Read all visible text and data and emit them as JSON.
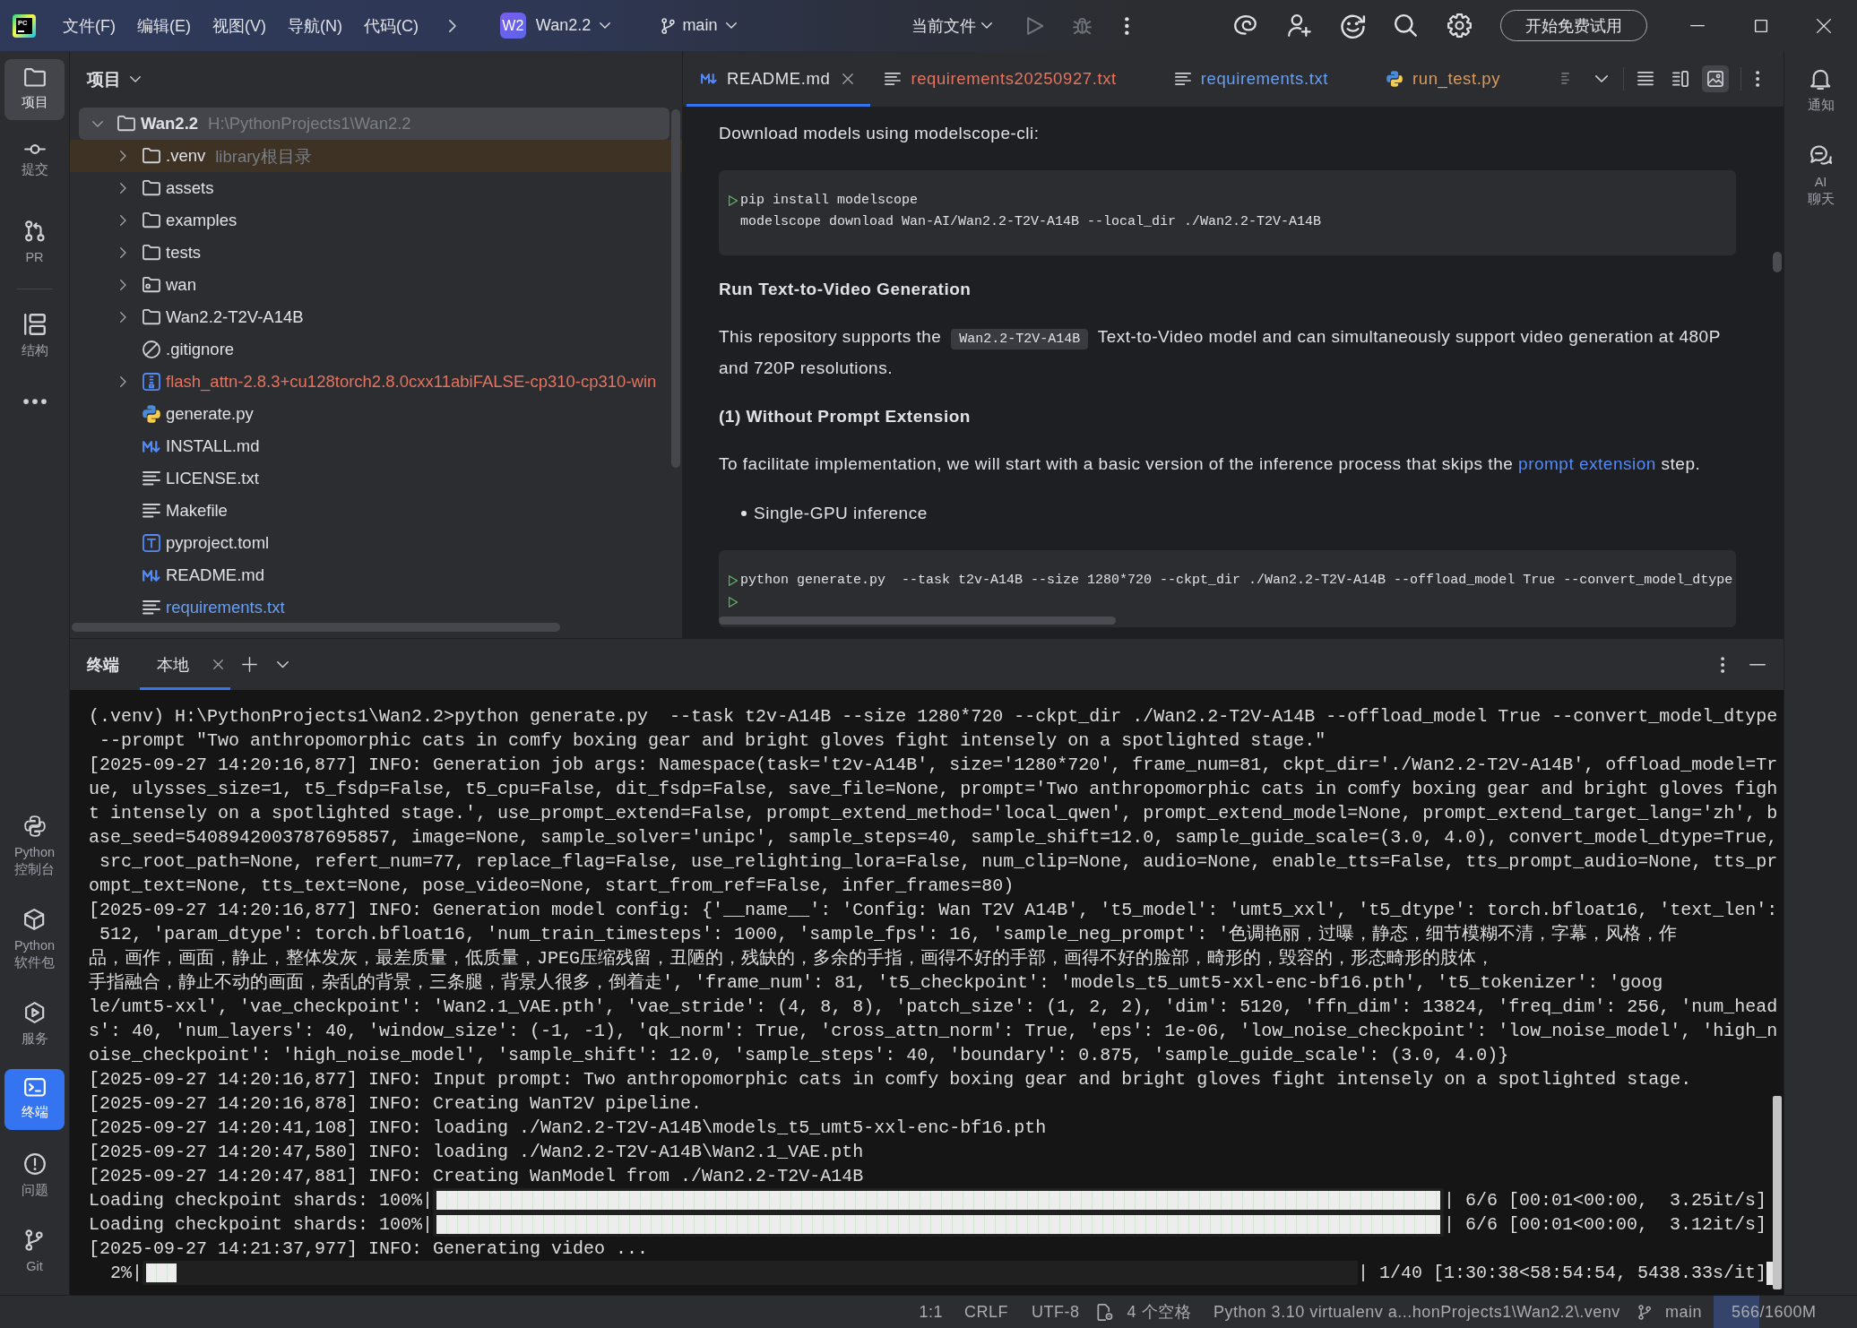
{
  "title_bar": {
    "logo": "PC",
    "menus": [
      "文件(F)",
      "编辑(E)",
      "视图(V)",
      "导航(N)",
      "代码(C)"
    ],
    "project": {
      "badge": "W2",
      "name": "Wan2.2"
    },
    "branch": "main",
    "run_config": "当前文件",
    "run_controls": [
      {
        "kind": "run",
        "disabled": true
      },
      {
        "kind": "debug",
        "disabled": true
      }
    ],
    "trial_button": "开始免费试用"
  },
  "left_toolbar": {
    "top_groups": [
      [
        {
          "kind": "folder",
          "label": "项目",
          "selected": true,
          "focused": false
        },
        {
          "kind": "commit",
          "label": "提交",
          "selected": false,
          "focused": false
        },
        {
          "kind": "pull-request",
          "label": "PR",
          "selected": false,
          "focused": false
        }
      ],
      [
        {
          "kind": "structure",
          "label": "结构",
          "selected": false,
          "focused": false
        }
      ]
    ],
    "bottom": [
      {
        "kind": "python-console",
        "label": "Python 控制台",
        "selected": false,
        "focused": false
      },
      {
        "kind": "python-packages",
        "label": "Python 软件包",
        "selected": false,
        "focused": false
      },
      {
        "kind": "services",
        "label": "服务",
        "selected": false,
        "focused": false
      },
      {
        "kind": "terminal",
        "label": "终端",
        "selected": true,
        "focused": true
      },
      {
        "kind": "problems",
        "label": "问题",
        "selected": false,
        "focused": false
      },
      {
        "kind": "git",
        "label": "Git",
        "selected": false,
        "focused": false
      }
    ]
  },
  "right_toolbar": {
    "items": [
      {
        "kind": "bell",
        "label": "通知"
      },
      {
        "kind": "ai-chat",
        "label": "AI 聊天"
      }
    ]
  },
  "project_panel": {
    "title": "项目",
    "tree": [
      {
        "name": "Wan2.2",
        "note": "H:\\PythonProjects1\\Wan2.2",
        "kind": "folder",
        "expanded": true,
        "selected": true,
        "highlighted": false,
        "color": "#dfe1e5",
        "children": [
          {
            "name": ".venv",
            "note": "library根目录",
            "kind": "folder",
            "expanded": false,
            "selected": false,
            "highlighted": true,
            "color": "#dfe1e5"
          },
          {
            "name": "assets",
            "kind": "folder",
            "expanded": false,
            "selected": false,
            "highlighted": false,
            "color": "#dfe1e5"
          },
          {
            "name": "examples",
            "kind": "folder",
            "expanded": false,
            "selected": false,
            "highlighted": false,
            "color": "#dfe1e5"
          },
          {
            "name": "tests",
            "kind": "folder",
            "expanded": false,
            "selected": false,
            "highlighted": false,
            "color": "#dfe1e5"
          },
          {
            "name": "wan",
            "kind": "package-folder",
            "expanded": false,
            "selected": false,
            "highlighted": false,
            "color": "#dfe1e5"
          },
          {
            "name": "Wan2.2-T2V-A14B",
            "kind": "folder",
            "expanded": false,
            "selected": false,
            "highlighted": false,
            "color": "#dfe1e5"
          },
          {
            "name": ".gitignore",
            "kind": "ignore",
            "selected": false,
            "highlighted": false,
            "color": "#dfe1e5"
          },
          {
            "name": "flash_attn-2.8.3+cu128torch2.8.0cxx11abiFALSE-cp310-cp310-win",
            "kind": "archive",
            "expanded": false,
            "selected": false,
            "highlighted": false,
            "color": "#e5735f"
          },
          {
            "name": "generate.py",
            "kind": "python",
            "selected": false,
            "highlighted": false,
            "color": "#dfe1e5"
          },
          {
            "name": "INSTALL.md",
            "kind": "markdown",
            "selected": false,
            "highlighted": false,
            "color": "#dfe1e5"
          },
          {
            "name": "LICENSE.txt",
            "kind": "text",
            "selected": false,
            "highlighted": false,
            "color": "#dfe1e5"
          },
          {
            "name": "Makefile",
            "kind": "text",
            "selected": false,
            "highlighted": false,
            "color": "#dfe1e5"
          },
          {
            "name": "pyproject.toml",
            "kind": "toml",
            "selected": false,
            "highlighted": false,
            "color": "#dfe1e5"
          },
          {
            "name": "README.md",
            "kind": "markdown",
            "selected": false,
            "highlighted": false,
            "color": "#dfe1e5"
          },
          {
            "name": "requirements.txt",
            "kind": "text",
            "selected": false,
            "highlighted": false,
            "color": "#6a9ff0"
          }
        ]
      }
    ]
  },
  "editor": {
    "tabs": [
      {
        "label": "README.md",
        "kind": "markdown",
        "selected": true,
        "color": "#dfe1e5"
      },
      {
        "label": "requirements20250927.txt",
        "kind": "text",
        "selected": false,
        "color": "#e5735f"
      },
      {
        "label": "requirements.txt",
        "kind": "text",
        "selected": false,
        "color": "#6a9ff0"
      },
      {
        "label": "run_test.py",
        "kind": "python",
        "selected": false,
        "color": "#d99a5e"
      }
    ],
    "view_modes": [
      {
        "kind": "editor",
        "selected": false
      },
      {
        "kind": "split",
        "selected": false
      },
      {
        "kind": "preview",
        "selected": true
      }
    ],
    "blocks": [
      {
        "kind": "paragraph",
        "parts": [
          {
            "kind": "text",
            "text": "Download models using modelscope-cli:"
          }
        ]
      },
      {
        "kind": "code",
        "scrollable": false,
        "lines": [
          {
            "text": "pip install modelscope",
            "run": true
          },
          {
            "text": "modelscope download Wan-AI/Wan2.2-T2V-A14B --local_dir ./Wan2.2-T2V-A14B",
            "run": false
          }
        ]
      },
      {
        "kind": "heading",
        "text": "Run Text-to-Video Generation"
      },
      {
        "kind": "paragraph",
        "parts": [
          {
            "kind": "text",
            "text": "This repository supports the "
          },
          {
            "kind": "code",
            "text": "Wan2.2-T2V-A14B"
          },
          {
            "kind": "text",
            "text": " Text-to-Video model and can simultaneously support video generation at 480P and 720P resolutions."
          }
        ]
      },
      {
        "kind": "heading",
        "text": "(1) Without Prompt Extension"
      },
      {
        "kind": "paragraph",
        "parts": [
          {
            "kind": "text",
            "text": "To facilitate implementation, we will start with a basic version of the inference process that skips the "
          },
          {
            "kind": "link",
            "text": "prompt extension"
          },
          {
            "kind": "text",
            "text": " step."
          }
        ]
      },
      {
        "kind": "bullets",
        "items": [
          "Single-GPU inference"
        ]
      },
      {
        "kind": "code",
        "scrollable": true,
        "lines": [
          {
            "text": "python generate.py  --task t2v-A14B --size 1280*720 --ckpt_dir ./Wan2.2-T2V-A14B --offload_model True --convert_model_dtype",
            "run": true
          },
          {
            "run": true
          }
        ]
      }
    ]
  },
  "terminal": {
    "title": "终端",
    "tabs": [
      {
        "label": "本地",
        "selected": true
      }
    ],
    "lines": [
      {
        "kind": "text",
        "text": "(.venv) H:\\PythonProjects1\\Wan2.2>python generate.py  --task t2v-A14B --size 1280*720 --ckpt_dir ./Wan2.2-T2V-A14B --offload_model True --convert_model_dtype"
      },
      {
        "kind": "text",
        "text": " --prompt \"Two anthropomorphic cats in comfy boxing gear and bright gloves fight intensely on a spotlighted stage.\""
      },
      {
        "kind": "text",
        "text": "[2025-09-27 14:20:16,877] INFO: Generation job args: Namespace(task='t2v-A14B', size='1280*720', frame_num=81, ckpt_dir='./Wan2.2-T2V-A14B', offload_model=Tr"
      },
      {
        "kind": "text",
        "text": "ue, ulysses_size=1, t5_fsdp=False, t5_cpu=False, dit_fsdp=False, save_file=None, prompt='Two anthropomorphic cats in comfy boxing gear and bright gloves figh"
      },
      {
        "kind": "text",
        "text": "t intensely on a spotlighted stage.', use_prompt_extend=False, prompt_extend_method='local_qwen', prompt_extend_model=None, prompt_extend_target_lang='zh', b"
      },
      {
        "kind": "text",
        "text": "ase_seed=5408942003787695857, image=None, sample_solver='unipc', sample_steps=40, sample_shift=12.0, sample_guide_scale=(3.0, 4.0), convert_model_dtype=True,"
      },
      {
        "kind": "text",
        "text": " src_root_path=None, refert_num=77, replace_flag=False, use_relighting_lora=False, num_clip=None, audio=None, enable_tts=False, tts_prompt_audio=None, tts_pr"
      },
      {
        "kind": "text",
        "text": "ompt_text=None, tts_text=None, pose_video=None, start_from_ref=False, infer_frames=80)"
      },
      {
        "kind": "text",
        "text": "[2025-09-27 14:20:16,877] INFO: Generation model config: {'__name__': 'Config: Wan T2V A14B', 't5_model': 'umt5_xxl', 't5_dtype': torch.bfloat16, 'text_len':"
      },
      {
        "kind": "text",
        "text": " 512, 'param_dtype': torch.bfloat16, 'num_train_timesteps': 1000, 'sample_fps': 16, 'sample_neg_prompt': '色调艳丽，过曝，静态，细节模糊不清，字幕，风格，作"
      },
      {
        "kind": "text",
        "text": "品，画作，画面，静止，整体发灰，最差质量，低质量，JPEG压缩残留，丑陋的，残缺的，多余的手指，画得不好的手部，画得不好的脸部，畸形的，毁容的，形态畸形的肢体，"
      },
      {
        "kind": "text",
        "text": "手指融合，静止不动的画面，杂乱的背景，三条腿，背景人很多，倒着走', 'frame_num': 81, 't5_checkpoint': 'models_t5_umt5-xxl-enc-bf16.pth', 't5_tokenizer': 'goog"
      },
      {
        "kind": "text",
        "text": "le/umt5-xxl', 'vae_checkpoint': 'Wan2.1_VAE.pth', 'vae_stride': (4, 8, 8), 'patch_size': (1, 2, 2), 'dim': 5120, 'ffn_dim': 13824, 'freq_dim': 256, 'num_head"
      },
      {
        "kind": "text",
        "text": "s': 40, 'num_layers': 40, 'window_size': (-1, -1), 'qk_norm': True, 'cross_attn_norm': True, 'eps': 1e-06, 'low_noise_checkpoint': 'low_noise_model', 'high_n"
      },
      {
        "kind": "text",
        "text": "oise_checkpoint': 'high_noise_model', 'sample_shift': 12.0, 'sample_steps': 40, 'boundary': 0.875, 'sample_guide_scale': (3.0, 4.0)}"
      },
      {
        "kind": "text",
        "text": "[2025-09-27 14:20:16,877] INFO: Input prompt: Two anthropomorphic cats in comfy boxing gear and bright gloves fight intensely on a spotlighted stage."
      },
      {
        "kind": "text",
        "text": "[2025-09-27 14:20:16,878] INFO: Creating WanT2V pipeline."
      },
      {
        "kind": "text",
        "text": "[2025-09-27 14:20:41,108] INFO: loading ./Wan2.2-T2V-A14B\\models_t5_umt5-xxl-enc-bf16.pth"
      },
      {
        "kind": "text",
        "text": "[2025-09-27 14:20:47,580] INFO: loading ./Wan2.2-T2V-A14B\\Wan2.1_VAE.pth"
      },
      {
        "kind": "text",
        "text": "[2025-09-27 14:20:47,881] INFO: Creating WanModel from ./Wan2.2-T2V-A14B"
      },
      {
        "kind": "progress",
        "label": "Loading checkpoint shards: 100%|",
        "level": 1,
        "stats": "| 6/6 [00:01<00:00,  3.25it/s]",
        "cursor": false
      },
      {
        "kind": "progress",
        "label": "Loading checkpoint shards: 100%|",
        "level": 1,
        "stats": "| 6/6 [00:01<00:00,  3.12it/s]",
        "cursor": false
      },
      {
        "kind": "text",
        "text": "[2025-09-27 14:21:37,977] INFO: Generating video ..."
      },
      {
        "kind": "progress",
        "label": "  2%|",
        "level": 0.025,
        "stats": "| 1/40 [1:30:38<58:54:54, 5438.33s/it]",
        "cursor": true
      }
    ]
  },
  "status_bar": {
    "position": "1:1",
    "line_separator": "CRLF",
    "encoding": "UTF-8",
    "indent": "4 个空格",
    "interpreter": "Python 3.10 virtualenv a...honProjects1\\Wan2.2\\.venv",
    "branch": "main",
    "memory": {
      "text": "566/1600M",
      "level": 0.32
    }
  }
}
